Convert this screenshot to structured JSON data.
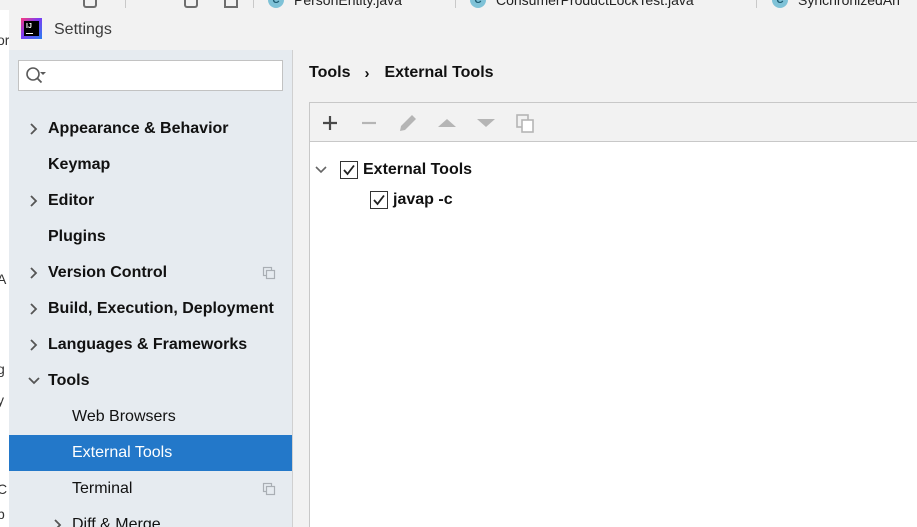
{
  "background": {
    "tabs": [
      {
        "label": "PersonEntity.java"
      },
      {
        "label": "ConsumerProductLockTest.java"
      },
      {
        "label": "SynchronizedAn"
      }
    ],
    "strip_glyphs": [
      "or",
      "A",
      "g",
      "y",
      "C",
      "p"
    ]
  },
  "window": {
    "title": "Settings",
    "logo_text": "IJ"
  },
  "sidebar": {
    "search": {
      "value": "",
      "placeholder": ""
    },
    "items": [
      {
        "label": "Appearance & Behavior",
        "expandable": true
      },
      {
        "label": "Keymap",
        "expandable": false
      },
      {
        "label": "Editor",
        "expandable": true
      },
      {
        "label": "Plugins",
        "expandable": false
      },
      {
        "label": "Version Control",
        "expandable": true,
        "project_icon": true
      },
      {
        "label": "Build, Execution, Deployment",
        "expandable": true
      },
      {
        "label": "Languages & Frameworks",
        "expandable": true
      },
      {
        "label": "Tools",
        "expanded": true
      },
      {
        "label": "Web Browsers",
        "sub": true
      },
      {
        "label": "External Tools",
        "sub": true,
        "selected": true
      },
      {
        "label": "Terminal",
        "sub": true,
        "project_icon": true
      },
      {
        "label": "Diff & Merge",
        "sub": true,
        "expandable": true
      }
    ]
  },
  "breadcrumb": {
    "parent": "Tools",
    "separator": "›",
    "current": "External Tools"
  },
  "toolbar": {
    "buttons": [
      "add-icon",
      "remove-icon",
      "edit-icon",
      "move-up-icon",
      "move-down-icon",
      "copy-icon"
    ]
  },
  "tree": {
    "group": {
      "label": "External Tools",
      "checked": true,
      "expanded": true
    },
    "children": [
      {
        "label": "javap -c",
        "checked": true
      }
    ]
  },
  "colors": {
    "selection": "#2378c9",
    "sidebar_bg": "#e6ebf0",
    "dialog_bg": "#f2f2f2"
  }
}
